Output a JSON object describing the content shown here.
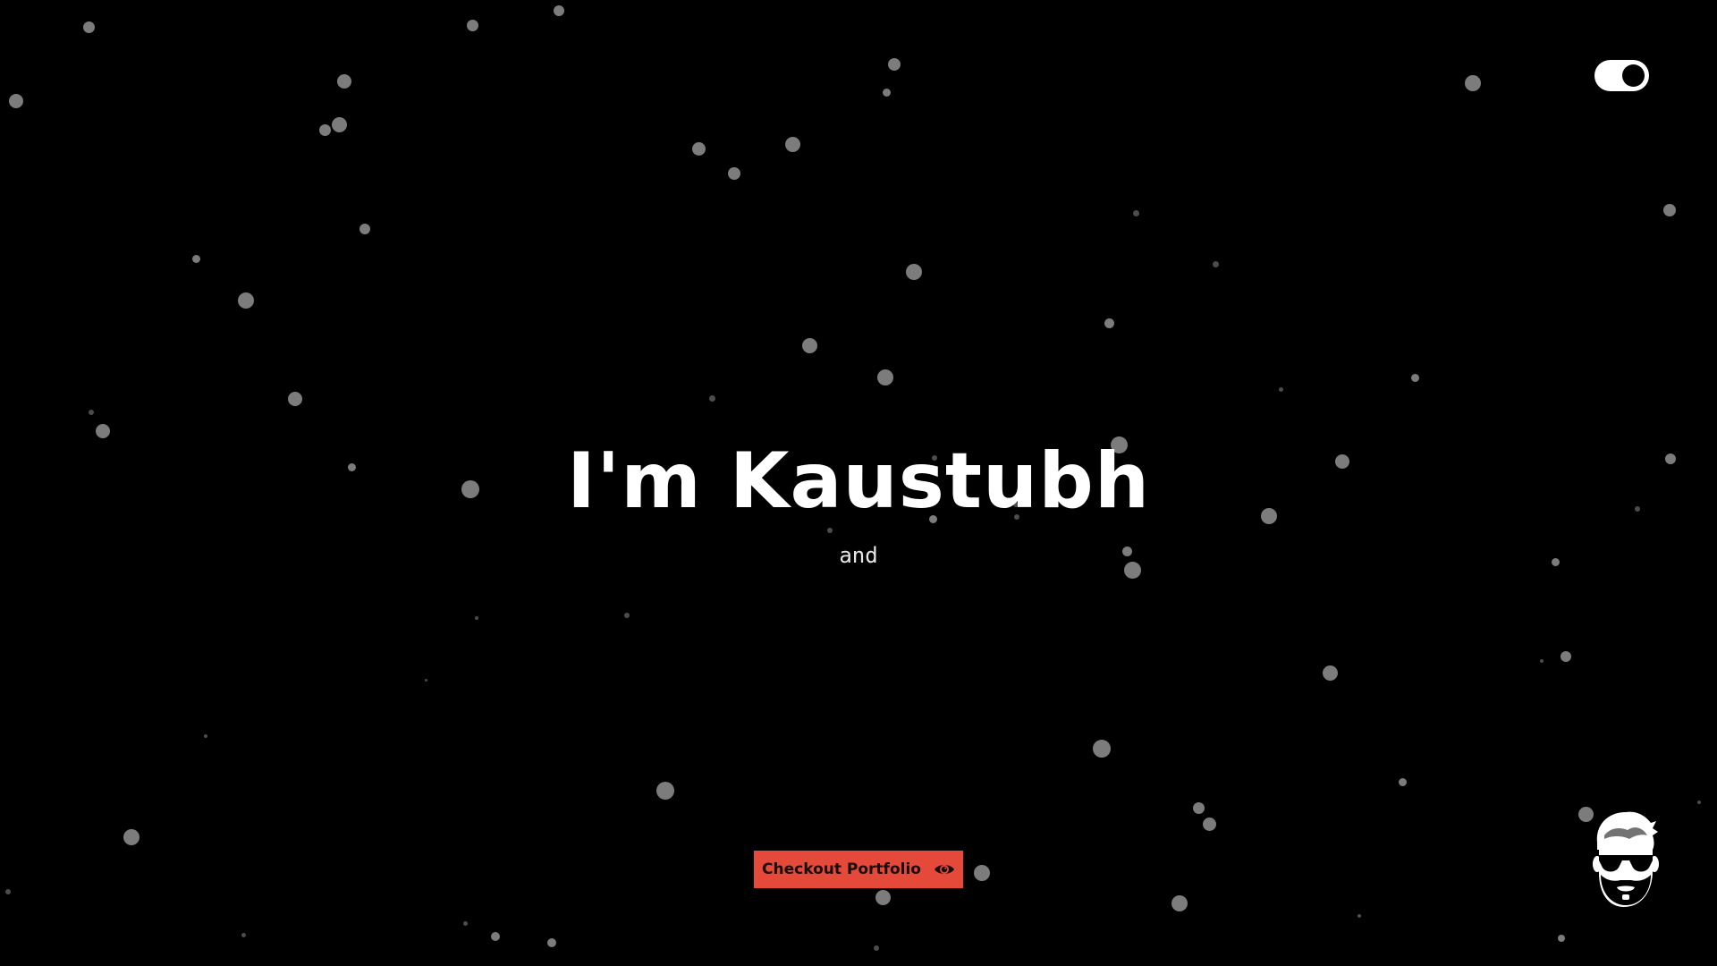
{
  "theme": {
    "background": "#000000",
    "accent": "#e4493a",
    "particle_color": "#8a8a8a",
    "toggle_color": "#ffffff"
  },
  "header": {
    "theme_toggle_state": "on",
    "theme_toggle_icon": "toggle-switch-icon"
  },
  "hero": {
    "title": "I'm Kaustubh",
    "subtitle": "and"
  },
  "cta": {
    "label": "Checkout Portfolio",
    "icon": "eye-icon"
  },
  "branding": {
    "logo_icon": "bearded-face-avatar-icon"
  }
}
